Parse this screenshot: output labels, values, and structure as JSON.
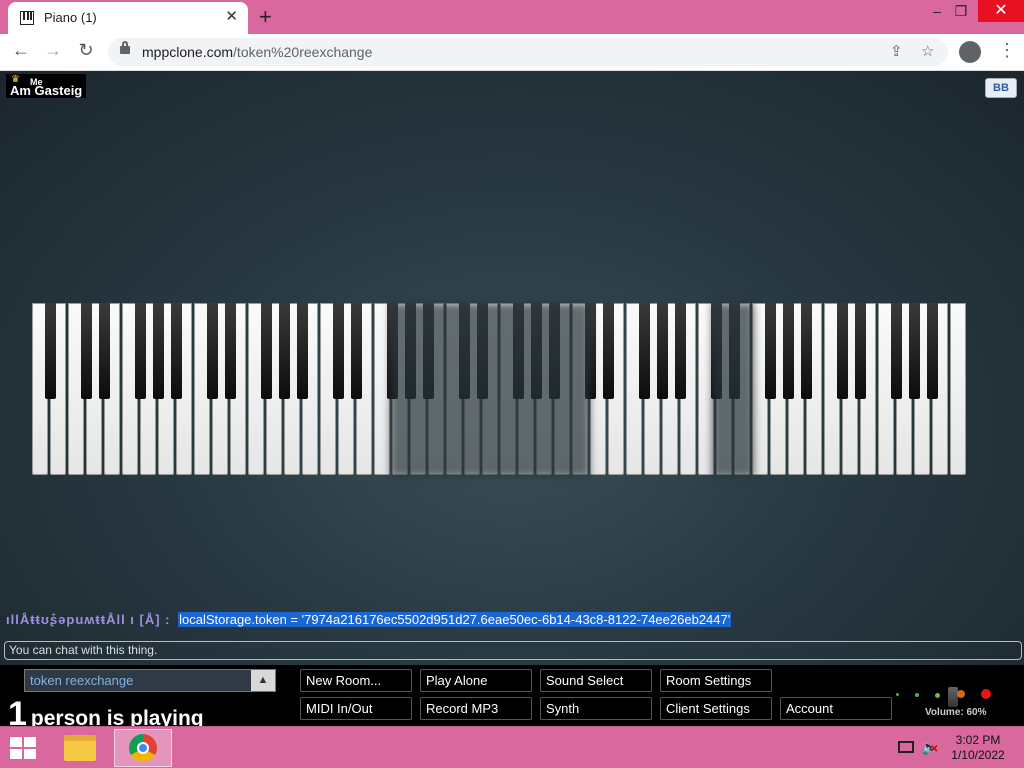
{
  "browser": {
    "tab_title": "Piano (1)",
    "tab_close": "✕",
    "new_tab": "+",
    "url_host": "mppclone.com",
    "url_path": "/token%20reexchange",
    "window_controls": {
      "minimize": "–",
      "restore": "❐",
      "close": "✕"
    },
    "icons": [
      "back-arrow-icon",
      "forward-arrow-icon",
      "reload-icon",
      "lock-icon",
      "share-icon",
      "star-icon",
      "profile-icon",
      "menu-kebab-icon"
    ]
  },
  "room": {
    "user_me_label": "Me",
    "user_name": "Am Gasteig",
    "bb_label": "BB"
  },
  "chat": {
    "nick": "ıllÅŧŧʊʂ͋ǝpuʍŧŧÅll ı [Å] :",
    "message": "localStorage.token = '7974a216176ec5502d951d27.6eae50ec-6b14-43c8-8122-74ee26eb2447'",
    "placeholder": "You can chat with this thing."
  },
  "controls": {
    "room_name": "token reexchange",
    "room_arrow": "▲",
    "player_count": "1",
    "player_text": "person is playing",
    "buttons": {
      "new_room": "New Room...",
      "play_alone": "Play Alone",
      "sound_select": "Sound Select",
      "room_settings": "Room Settings",
      "midi": "MIDI In/Out",
      "record_mp3": "Record MP3",
      "synth": "Synth",
      "client_settings": "Client Settings",
      "account": "Account"
    },
    "volume_label": "Volume: 60%",
    "volume_level": 0.6
  },
  "taskbar": {
    "time": "3:02 PM",
    "date": "1/10/2022"
  },
  "colors": {
    "accent_pink": "#d9689e",
    "chat_highlight": "#1a66d2",
    "nick_color": "#9f8fe4"
  }
}
